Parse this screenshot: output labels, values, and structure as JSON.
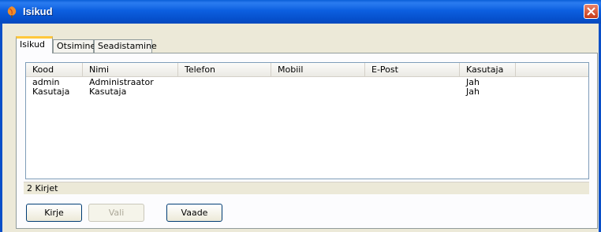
{
  "window": {
    "title": "Isikud"
  },
  "tabs": [
    {
      "label": "Isikud",
      "active": true
    },
    {
      "label": "Otsimine",
      "active": false
    },
    {
      "label": "Seadistamine",
      "active": false
    }
  ],
  "table": {
    "columns": [
      "Kood",
      "Nimi",
      "Telefon",
      "Mobiil",
      "E-Post",
      "Kasutaja"
    ],
    "rows": [
      [
        "admin",
        "Administraator",
        "",
        "",
        "",
        "Jah"
      ],
      [
        "Kasutaja",
        "Kasutaja",
        "",
        "",
        "",
        "Jah"
      ]
    ]
  },
  "status": {
    "text": "2 Kirjet"
  },
  "buttons": {
    "kirje": "Kirje",
    "vali": "Vali",
    "vaade": "Vaade"
  },
  "colors": {
    "title_bar": "#0650cc",
    "tab_highlight": "#ffc83c",
    "close": "#c63a18"
  },
  "icons": {
    "app": "leaf-icon",
    "close": "close-icon"
  }
}
